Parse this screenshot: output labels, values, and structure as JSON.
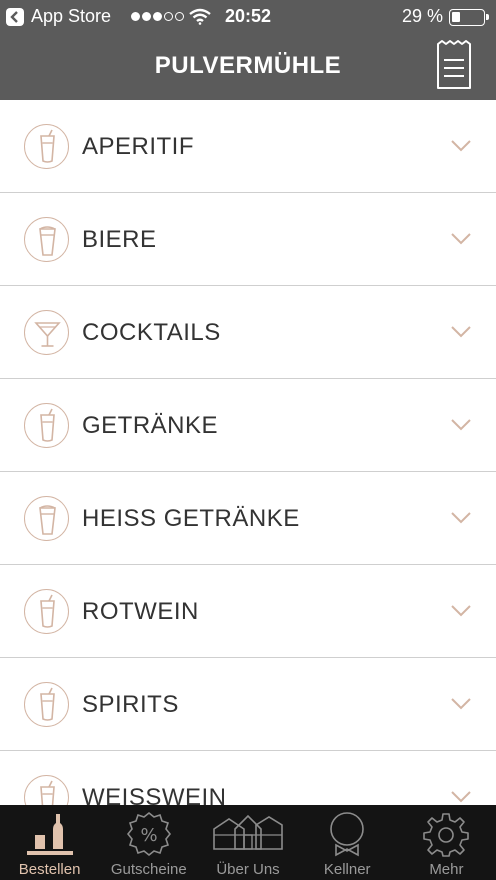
{
  "status_bar": {
    "carrier": "App Store",
    "time": "20:52",
    "battery": "29 %",
    "signal_dots": 5,
    "signal_strength": 3
  },
  "nav": {
    "title": "PULVERMÜHLE"
  },
  "categories": [
    {
      "label": "APERITIF",
      "icon": "glass-icon"
    },
    {
      "label": "BIERE",
      "icon": "beer-glass-icon"
    },
    {
      "label": "COCKTAILS",
      "icon": "cocktail-glass-icon"
    },
    {
      "label": "GETRÄNKE",
      "icon": "glass-icon"
    },
    {
      "label": "HEISS GETRÄNKE",
      "icon": "beer-glass-icon"
    },
    {
      "label": "ROTWEIN",
      "icon": "glass-icon"
    },
    {
      "label": "SPIRITS",
      "icon": "glass-icon"
    },
    {
      "label": "WEISSWEIN",
      "icon": "glass-icon"
    }
  ],
  "tabs": [
    {
      "label": "Bestellen",
      "icon": "bottles-icon",
      "active": true
    },
    {
      "label": "Gutscheine",
      "icon": "percent-badge-icon",
      "active": false
    },
    {
      "label": "Über Uns",
      "icon": "houses-icon",
      "active": false
    },
    {
      "label": "Kellner",
      "icon": "waiter-icon",
      "active": false
    },
    {
      "label": "Mehr",
      "icon": "gear-icon",
      "active": false
    }
  ],
  "colors": {
    "header_bg": "#5b5b5b",
    "accent": "#d3b5a4",
    "tab_bar_bg": "#141414",
    "tab_active": "#e0c2ad",
    "tab_inactive": "#9a9a9a"
  }
}
